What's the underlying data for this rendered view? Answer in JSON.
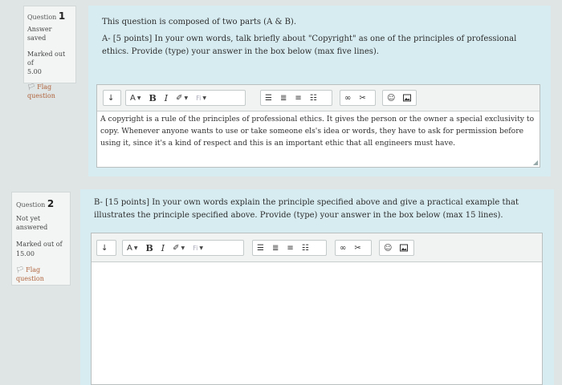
{
  "q1": {
    "label": "Question",
    "number": "1",
    "status": "Answer saved",
    "marked_label": "Marked out of",
    "marked_value": "5.00",
    "flag_label": "Flag question",
    "intro": "This question is composed of two parts (A & B).",
    "text": "A- [5 points] In your own words, talk briefly about \"Copyright\" as one of the principles of professional ethics. Provide (type) your answer in the box below (max five lines).",
    "answer": "A copyright is a rule of the principles of professional ethics. It gives the person or the owner a special exclusivity to copy. Whenever anyone wants to use or take someone els's idea or words, they have to ask for permission before using it, since it's a kind of respect and this is an important ethic that all engineers must have."
  },
  "q2": {
    "label": "Question",
    "number": "2",
    "status": "Not yet answered",
    "marked_label": "Marked out of",
    "marked_value": "15.00",
    "flag_label": "Flag question",
    "text": "B- [15 points] In your own words explain the principle specified above and give a practical example that illustrates the principle specified above. Provide (type) your answer in the box below (max 15 lines).",
    "answer": ""
  },
  "toolbar": {
    "font_color_label": "A",
    "bold_label": "B",
    "italic_label": "I",
    "font_family_label": "Fi"
  },
  "colors": {
    "flag": "#b0643c",
    "formulation_bg": "#d7ecf1",
    "page_bg": "#dfe4e4"
  },
  "icons": [
    "toggle-toolbar-icon",
    "chevron-down-icon",
    "brush-icon",
    "unordered-list-icon",
    "ordered-list-icon",
    "outdent-icon",
    "indent-icon",
    "link-icon",
    "unlink-icon",
    "emoji-icon",
    "image-icon",
    "flag-icon",
    "resize-handle-icon"
  ]
}
